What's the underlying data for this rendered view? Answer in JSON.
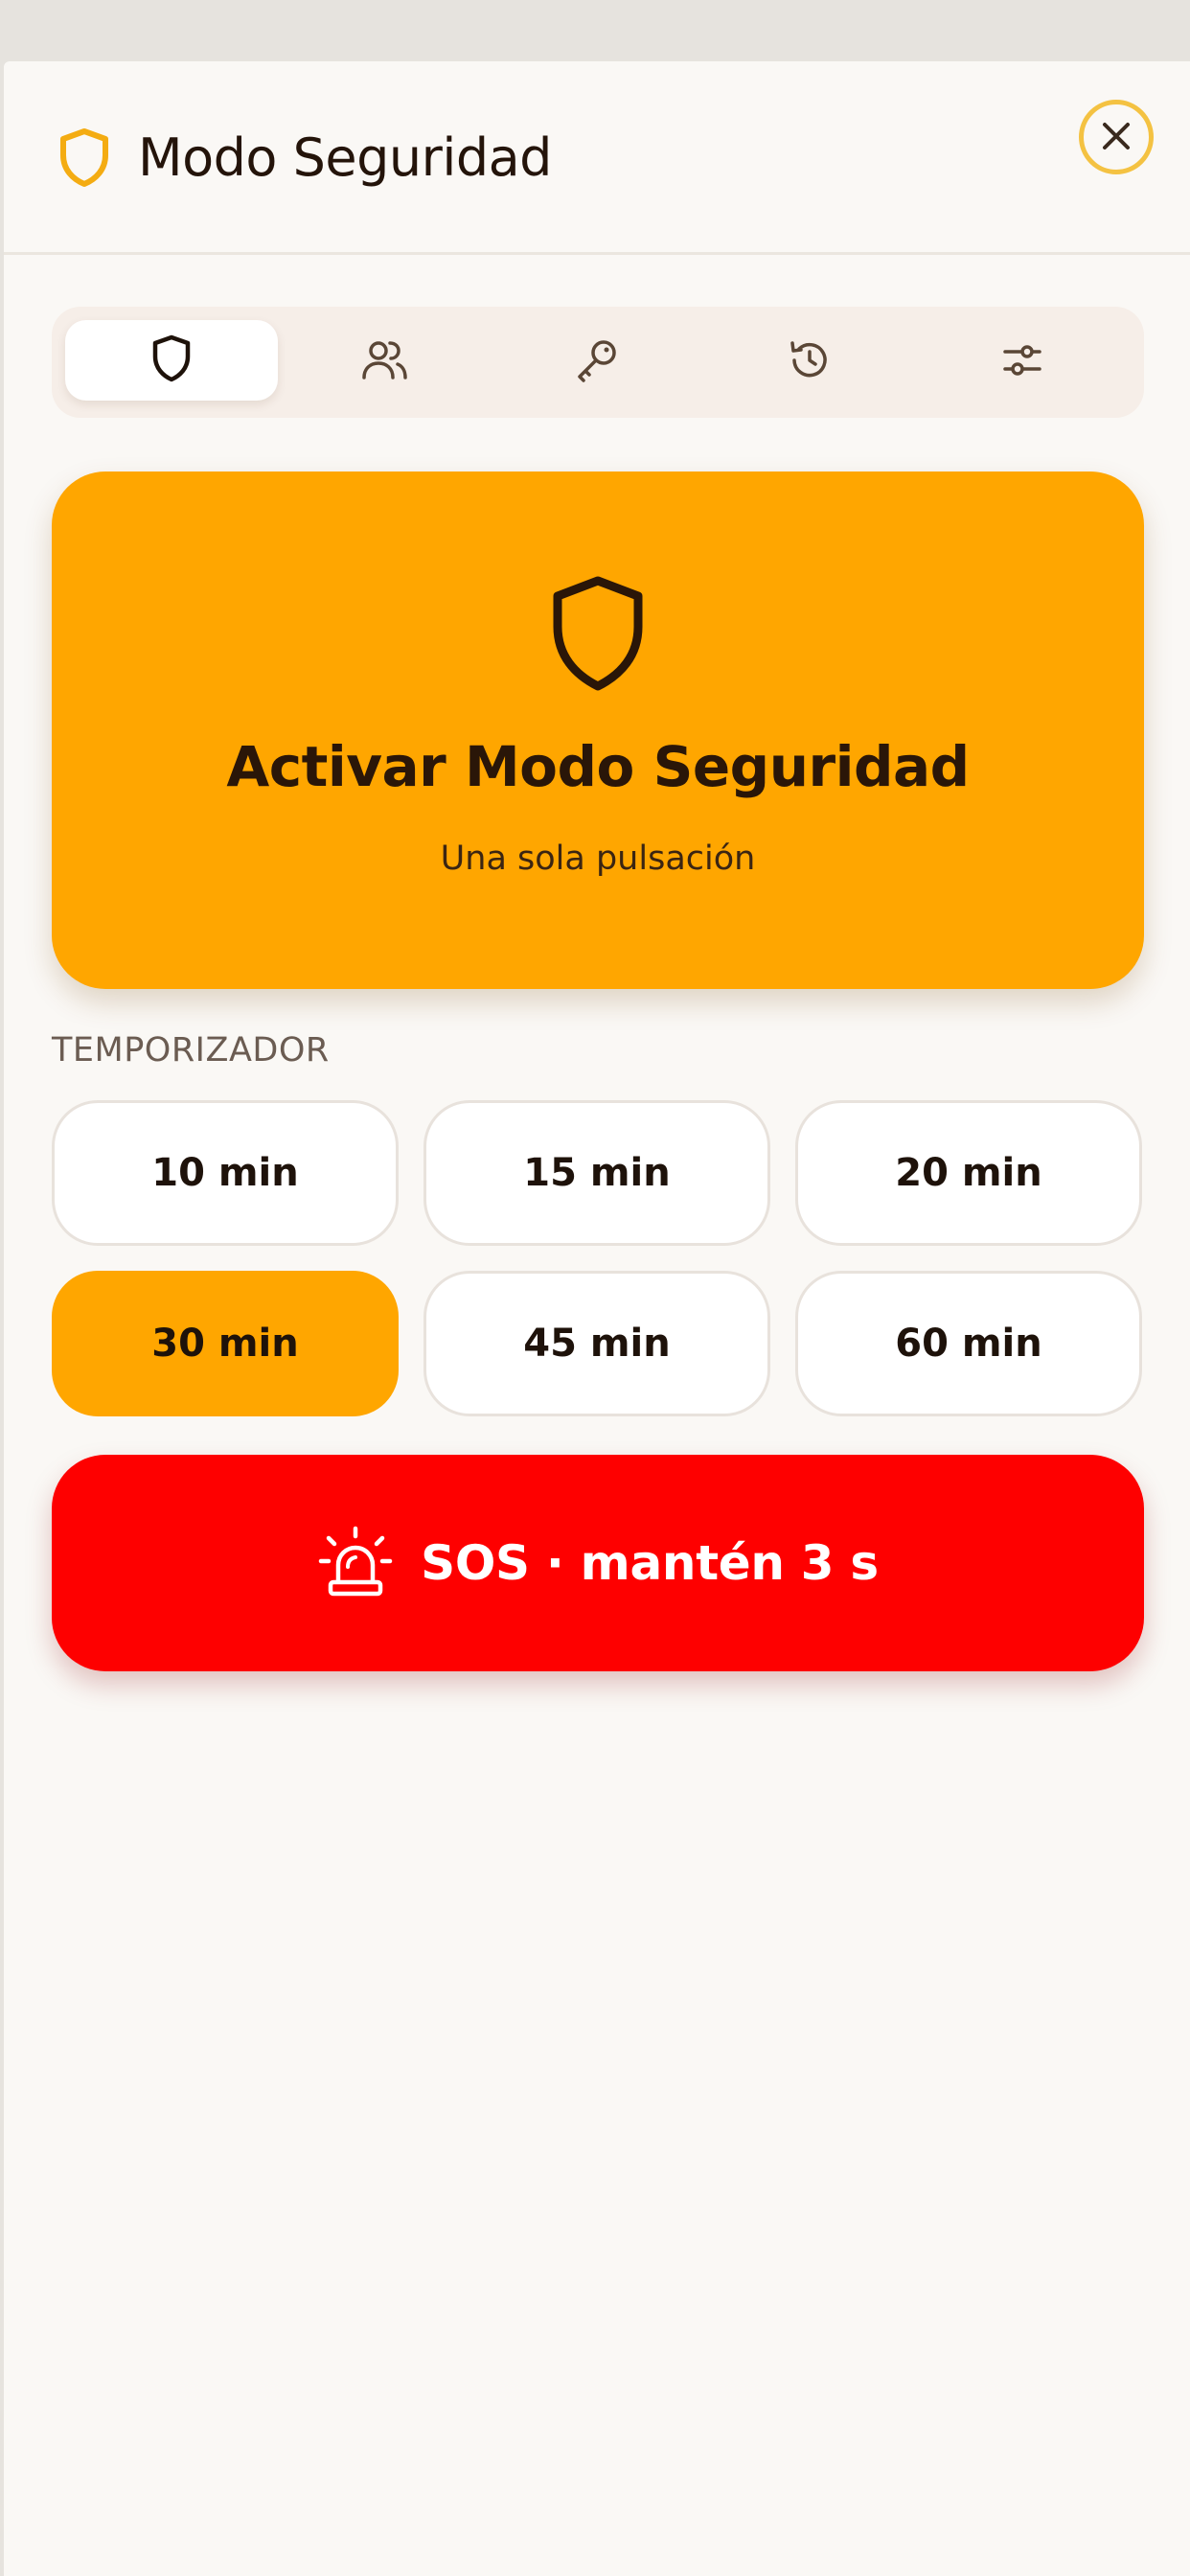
{
  "header": {
    "title": "Modo Seguridad",
    "icon": "shield-icon",
    "close_icon": "close-icon"
  },
  "tabs": [
    {
      "icon": "shield-icon",
      "active": true
    },
    {
      "icon": "users-icon",
      "active": false
    },
    {
      "icon": "key-icon",
      "active": false
    },
    {
      "icon": "history-icon",
      "active": false
    },
    {
      "icon": "sliders-icon",
      "active": false
    }
  ],
  "hero": {
    "title": "Activar Modo Seguridad",
    "subtitle": "Una sola pulsación",
    "icon": "shield-icon"
  },
  "timer": {
    "label": "TEMPORIZADOR",
    "options": [
      "10 min",
      "15 min",
      "20 min",
      "30 min",
      "45 min",
      "60 min"
    ],
    "selected": "30 min"
  },
  "sos": {
    "label": "SOS · mantén 3 s",
    "icon": "siren-icon"
  },
  "colors": {
    "accent": "#ffa600",
    "danger": "#fe0000",
    "background": "#faf8f5",
    "close_ring": "#f4c242"
  }
}
